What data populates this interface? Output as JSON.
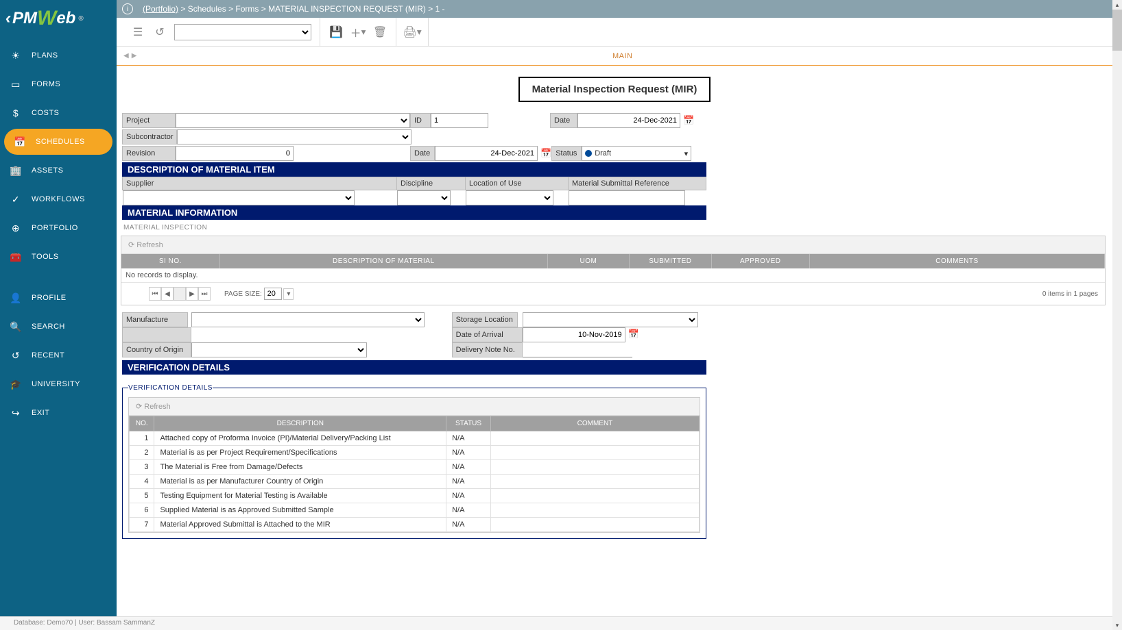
{
  "app": {
    "logo_pm": "PM",
    "logo_w": "W",
    "logo_eb": "eb",
    "reg": "®"
  },
  "sidebar": {
    "items": [
      {
        "label": "PLANS",
        "icon": "☀"
      },
      {
        "label": "FORMS",
        "icon": "▭"
      },
      {
        "label": "COSTS",
        "icon": "$"
      },
      {
        "label": "SCHEDULES",
        "icon": "📅"
      },
      {
        "label": "ASSETS",
        "icon": "🏢"
      },
      {
        "label": "WORKFLOWS",
        "icon": "✓"
      },
      {
        "label": "PORTFOLIO",
        "icon": "⊕"
      },
      {
        "label": "TOOLS",
        "icon": "🧰"
      },
      {
        "label": "PROFILE",
        "icon": "👤"
      },
      {
        "label": "SEARCH",
        "icon": "🔍"
      },
      {
        "label": "RECENT",
        "icon": "↺"
      },
      {
        "label": "UNIVERSITY",
        "icon": "🎓"
      },
      {
        "label": "EXIT",
        "icon": "↪"
      }
    ]
  },
  "breadcrumb": {
    "portfolio": "(Portfolio)",
    "rest": " > Schedules > Forms > MATERIAL INSPECTION REQUEST (MIR) > 1 -"
  },
  "tabs": {
    "main": "MAIN"
  },
  "title": "Material Inspection Request (MIR)",
  "header": {
    "project_lbl": "Project",
    "project_val": "",
    "id_lbl": "ID",
    "id_val": "1",
    "date_lbl": "Date",
    "date_val": "24-Dec-2021",
    "sub_lbl": "Subcontractor",
    "sub_val": "",
    "rev_lbl": "Revision",
    "rev_val": "0",
    "rev_date_lbl": "Date",
    "rev_date_val": "24-Dec-2021",
    "status_lbl": "Status",
    "status_val": "Draft"
  },
  "sections": {
    "desc": "DESCRIPTION OF MATERIAL ITEM",
    "matinfo": "MATERIAL INFORMATION",
    "verif": "VERIFICATION DETAILS"
  },
  "desc_fields": {
    "supplier": "Supplier",
    "discipline": "Discipline",
    "location": "Location of Use",
    "matref": "Material Submittal Reference"
  },
  "matgrid": {
    "sub": "MATERIAL INSPECTION",
    "refresh": "Refresh",
    "cols": [
      "SI NO.",
      "DESCRIPTION OF MATERIAL",
      "UOM",
      "SUBMITTED",
      "APPROVED",
      "COMMENTS"
    ],
    "empty": "No records to display.",
    "pagesize_lbl": "PAGE SIZE:",
    "pagesize": "20",
    "info": "0 items in 1 pages"
  },
  "matfields": {
    "manu": "Manufacture",
    "storage": "Storage Location",
    "origin": "Country of Origin",
    "arrival_lbl": "Date of Arrival",
    "arrival_val": "10-Nov-2019",
    "delivery": "Delivery Note No."
  },
  "verif": {
    "sub": "VERIFICATION DETAILS",
    "refresh": "Refresh",
    "cols": [
      "NO.",
      "DESCRIPTION",
      "STATUS",
      "COMMENT"
    ],
    "rows": [
      {
        "no": "1",
        "desc": "Attached copy of Proforma Invoice (PI)/Material Delivery/Packing List",
        "status": "N/A",
        "comment": ""
      },
      {
        "no": "2",
        "desc": "Material is as per Project Requirement/Specifications",
        "status": "N/A",
        "comment": ""
      },
      {
        "no": "3",
        "desc": "The Material is Free from Damage/Defects",
        "status": "N/A",
        "comment": ""
      },
      {
        "no": "4",
        "desc": "Material is as per Manufacturer Country of Origin",
        "status": "N/A",
        "comment": ""
      },
      {
        "no": "5",
        "desc": "Testing Equipment for Material Testing is Available",
        "status": "N/A",
        "comment": ""
      },
      {
        "no": "6",
        "desc": "Supplied Material is as Approved Submitted Sample",
        "status": "N/A",
        "comment": ""
      },
      {
        "no": "7",
        "desc": "Material Approved Submittal is Attached to the MIR",
        "status": "N/A",
        "comment": ""
      }
    ]
  },
  "footer": "Database: Demo70 | User: Bassam SammanZ"
}
